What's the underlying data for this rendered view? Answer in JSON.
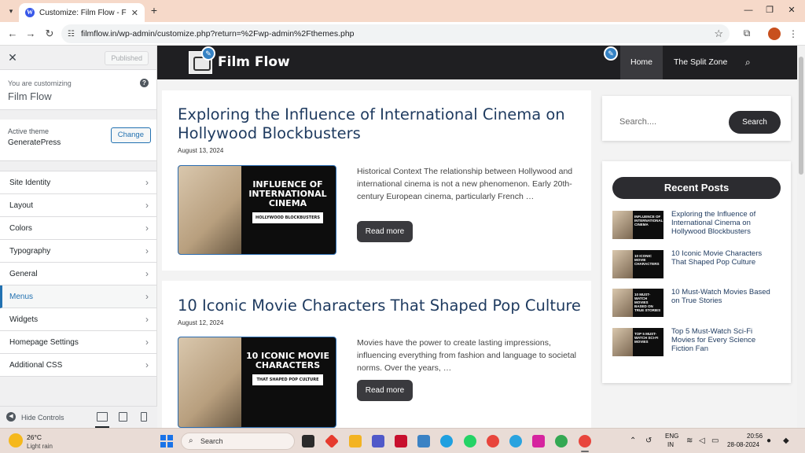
{
  "browser": {
    "tab_title": "Customize: Film Flow - Flowing",
    "url": "filmflow.in/wp-admin/customize.php?return=%2Fwp-admin%2Fthemes.php"
  },
  "customizer": {
    "published_label": "Published",
    "customizing_label": "You are customizing",
    "site_name": "Film Flow",
    "active_theme_label": "Active theme",
    "theme_name": "GeneratePress",
    "change_label": "Change",
    "sections": [
      {
        "label": "Site Identity"
      },
      {
        "label": "Layout"
      },
      {
        "label": "Colors"
      },
      {
        "label": "Typography"
      },
      {
        "label": "General"
      },
      {
        "label": "Menus",
        "active": true
      },
      {
        "label": "Widgets"
      },
      {
        "label": "Homepage Settings"
      },
      {
        "label": "Additional CSS"
      }
    ],
    "hide_controls_label": "Hide Controls"
  },
  "site": {
    "title": "Film Flow",
    "nav": [
      {
        "label": "Home",
        "active": true
      },
      {
        "label": "The Split Zone"
      }
    ],
    "posts": [
      {
        "title": "Exploring the Influence of International Cinema on Hollywood Blockbusters",
        "date": "August 13, 2024",
        "thumb_text": "INFLUENCE OF INTERNATIONAL CINEMA",
        "thumb_sub": "HOLLYWOOD BLOCKBUSTERS",
        "excerpt": "Historical Context The relationship between Hollywood and international cinema is not a new phenomenon. Early 20th-century European cinema, particularly French …",
        "read_more": "Read more"
      },
      {
        "title": "10 Iconic Movie Characters That Shaped Pop Culture",
        "date": "August 12, 2024",
        "thumb_text": "10 ICONIC MOVIE CHARACTERS",
        "thumb_sub": "THAT SHAPED POP CULTURE",
        "excerpt": "Movies have the power to create lasting impressions, influencing everything from fashion and language to societal norms. Over the years, …",
        "read_more": "Read more"
      }
    ],
    "search": {
      "placeholder": "Search....",
      "button": "Search"
    },
    "recent_posts": {
      "heading": "Recent Posts",
      "items": [
        {
          "title": "Exploring the Influence of International Cinema on Hollywood Blockbusters",
          "thumb": "INFLUENCE OF INTERNATIONAL CINEMA"
        },
        {
          "title": "10 Iconic Movie Characters That Shaped Pop Culture",
          "thumb": "10 ICONIC MOVIE CHARACTERS"
        },
        {
          "title": "10 Must-Watch Movies Based on True Stories",
          "thumb": "10 MUST-WATCH MOVIES BASED ON TRUE STORIES"
        },
        {
          "title": "Top 5 Must-Watch Sci-Fi Movies for Every Science Fiction Fan",
          "thumb": "TOP 5 MUST-WATCH SCI-FI MOVIES"
        }
      ]
    }
  },
  "taskbar": {
    "weather_temp": "26°C",
    "weather_desc": "Light rain",
    "search_label": "Search",
    "lang1": "ENG",
    "lang2": "IN",
    "time": "20:56",
    "date": "28-08-2024"
  },
  "colors": {
    "header_bg": "#1f1f22",
    "accent_blue": "#2271b1",
    "title_blue": "#1e3a5f",
    "button_dark": "#3a3a3e"
  }
}
